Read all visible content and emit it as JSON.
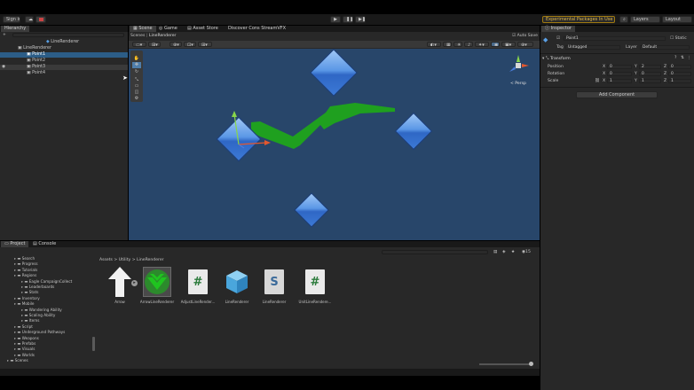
{
  "topbar": {
    "account_label": "Sign in",
    "cloud_icon": "cloud-icon",
    "play_icon": "play-icon",
    "pause_icon": "pause-icon",
    "step_icon": "step-icon",
    "packages_label": "Experimental Packages In Use",
    "search_icon": "search-icon",
    "layers_label": "Layers",
    "layout_label": "Layout"
  },
  "hierarchy": {
    "tab_label": "Hierarchy",
    "add_label": "+",
    "scene_name": "LineRenderer",
    "items": [
      {
        "label": "LineRenderer",
        "selected": false,
        "indent": 1
      },
      {
        "label": "Point1",
        "selected": true,
        "indent": 2
      },
      {
        "label": "Point2",
        "selected": false,
        "indent": 2
      },
      {
        "label": "Point3",
        "selected": false,
        "indent": 2
      },
      {
        "label": "Point4",
        "selected": false,
        "indent": 2
      }
    ]
  },
  "scene_view": {
    "tabs": [
      "Scene",
      "Game",
      "Asset Store",
      "Discover Cons StreamVFX"
    ],
    "breadcrumb": [
      "Scenes",
      "LineRenderer"
    ],
    "auto_save_label": "Auto Save",
    "persp_label": "< Persp",
    "colors": {
      "background": "#28466a",
      "arrow": "#1fa01f"
    }
  },
  "inspector": {
    "tab_label": "Inspector",
    "object_name": "Point1",
    "static_label": "Static",
    "tag_label": "Tag",
    "tag_value": "Untagged",
    "layer_label": "Layer",
    "layer_value": "Default",
    "transform_label": "Transform",
    "rows": [
      {
        "label": "Position",
        "x": "0",
        "y": "2",
        "z": "0"
      },
      {
        "label": "Rotation",
        "x": "0",
        "y": "0",
        "z": "0"
      },
      {
        "label": "Scale",
        "x": "1",
        "y": "1",
        "z": "1"
      }
    ],
    "axis_x": "X",
    "axis_y": "Y",
    "axis_z": "Z",
    "add_component_label": "Add Component"
  },
  "project": {
    "tabs": [
      "Project",
      "Console"
    ],
    "breadcrumb": "Assets > Utility > LineRenderer",
    "count_label": "15",
    "tree": [
      {
        "label": "Search",
        "indent": 2
      },
      {
        "label": "Progress",
        "indent": 2
      },
      {
        "label": "Tutorials",
        "indent": 2
      },
      {
        "label": "Regions",
        "indent": 2
      },
      {
        "label": "Eagle CampaignCollect",
        "indent": 3
      },
      {
        "label": "Leaderboards",
        "indent": 3
      },
      {
        "label": "Stats",
        "indent": 3
      },
      {
        "label": "Inventory",
        "indent": 2
      },
      {
        "label": "Mobile",
        "indent": 2
      },
      {
        "label": "Wandering Ability",
        "indent": 3
      },
      {
        "label": "Scaling Ability",
        "indent": 3
      },
      {
        "label": "Items",
        "indent": 3
      },
      {
        "label": "Script",
        "indent": 2
      },
      {
        "label": "Underground Pathways",
        "indent": 2
      },
      {
        "label": "Weapons",
        "indent": 2
      },
      {
        "label": "Prefabs",
        "indent": 2
      },
      {
        "label": "Visuals",
        "indent": 2
      },
      {
        "label": "Worlds",
        "indent": 2
      },
      {
        "label": "Scenes",
        "indent": 1
      }
    ],
    "assets": [
      {
        "label": "Arrow",
        "kind": "arrow"
      },
      {
        "label": "ArrowLineRenderer",
        "kind": "green-arrow"
      },
      {
        "label": "AdjustLineRender...",
        "kind": "script"
      },
      {
        "label": "LineRenderer",
        "kind": "cube"
      },
      {
        "label": "LineRenderer",
        "kind": "shader"
      },
      {
        "label": "UnitLineRendere...",
        "kind": "script"
      }
    ]
  }
}
